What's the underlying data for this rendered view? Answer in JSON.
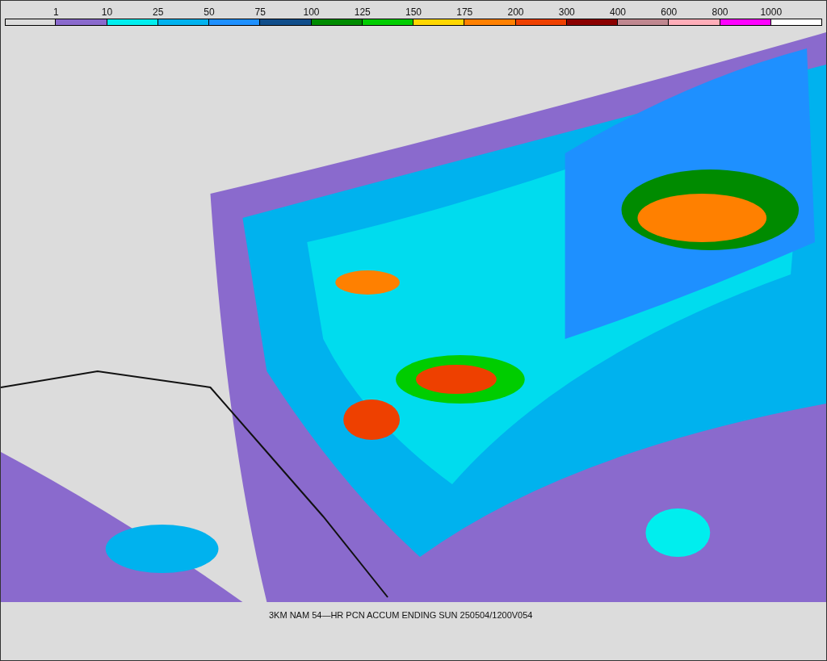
{
  "legend": {
    "bins": [
      {
        "color": "#dcdcdc"
      },
      {
        "label": "1",
        "color": "#8a6acd"
      },
      {
        "label": "10",
        "color": "#00eeee"
      },
      {
        "label": "25",
        "color": "#00b2ee"
      },
      {
        "label": "50",
        "color": "#1e90ff"
      },
      {
        "label": "75",
        "color": "#104e8b"
      },
      {
        "label": "100",
        "color": "#008b00"
      },
      {
        "label": "125",
        "color": "#00cd00"
      },
      {
        "label": "150",
        "color": "#ffd700"
      },
      {
        "label": "175",
        "color": "#ff8000"
      },
      {
        "label": "200",
        "color": "#ee4000"
      },
      {
        "label": "300",
        "color": "#8b0000"
      },
      {
        "label": "400",
        "color": "#c08890"
      },
      {
        "label": "600",
        "color": "#ffaeb9"
      },
      {
        "label": "800",
        "color": "#ff00ff"
      },
      {
        "label": "1000",
        "color": "#ffffff"
      }
    ]
  },
  "caption": "3KM NAM 54—HR PCN ACCUM ENDING SUN 250504/1200V054"
}
